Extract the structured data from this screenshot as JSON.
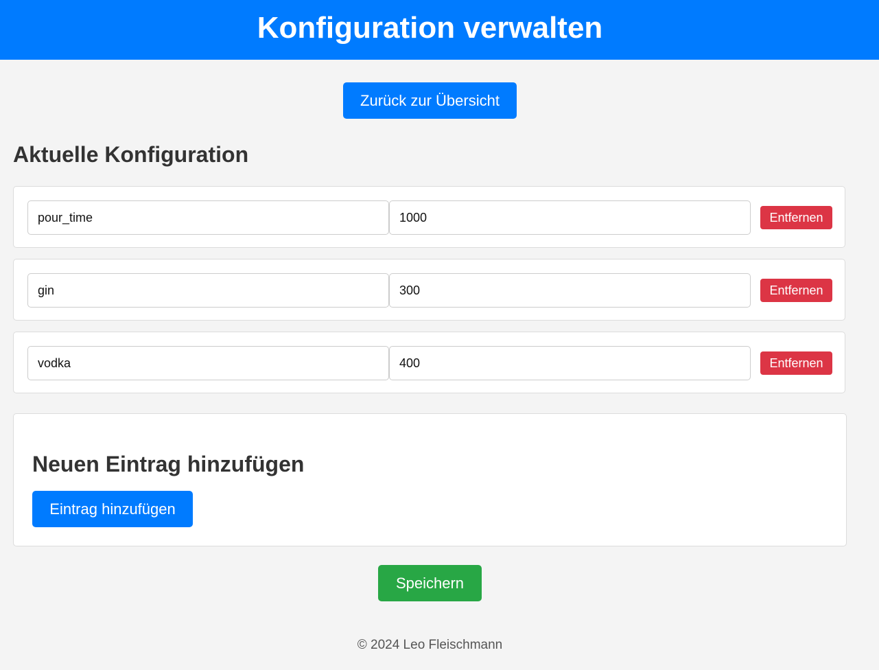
{
  "header": {
    "title": "Konfiguration verwalten"
  },
  "nav": {
    "back_label": "Zurück zur Übersicht"
  },
  "config": {
    "title": "Aktuelle Konfiguration",
    "remove_label": "Entfernen",
    "entries": [
      {
        "key": "pour_time",
        "value": "1000"
      },
      {
        "key": "gin",
        "value": "300"
      },
      {
        "key": "vodka",
        "value": "400"
      }
    ]
  },
  "add": {
    "title": "Neuen Eintrag hinzufügen",
    "button_label": "Eintrag hinzufügen"
  },
  "actions": {
    "save_label": "Speichern"
  },
  "footer": {
    "text": "© 2024 Leo Fleischmann"
  },
  "colors": {
    "primary": "#007bff",
    "success": "#28a745",
    "danger": "#dc3545",
    "background": "#f4f4f4"
  }
}
